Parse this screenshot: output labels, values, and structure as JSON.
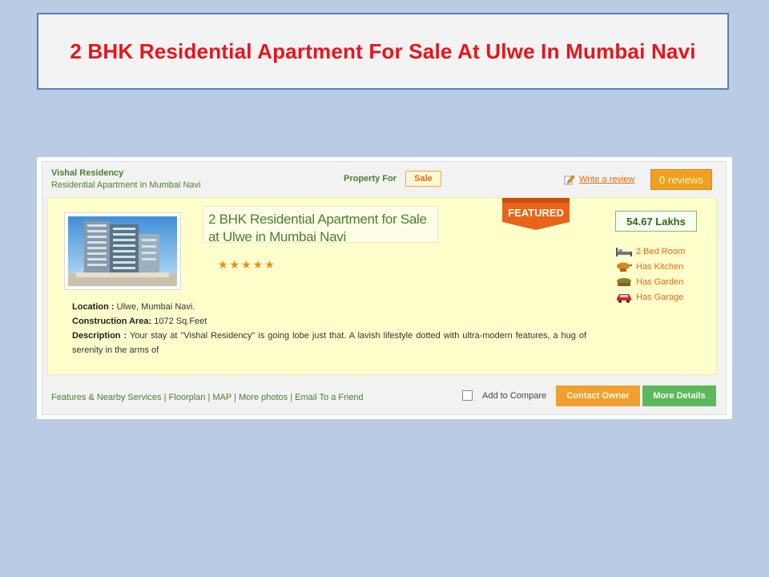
{
  "slide_title": "2 BHK Residential  Apartment  For Sale  At Ulwe In Mumbai  Navi",
  "listing": {
    "name": "Vishal Residency",
    "subtitle": "Residential Apartment in Mumbai Navi",
    "property_for_label": "Property For",
    "property_for_value": "Sale",
    "write_review": "Write a review",
    "reviews": "0 reviews",
    "title": "2 BHK Residential Apartment for Sale at Ulwe in Mumbai Navi",
    "rating_stars": 5,
    "featured": "FEATURED",
    "price": "54.67 Lakhs",
    "amenities": [
      {
        "label": "2 Bed Room",
        "icon": "bed-icon"
      },
      {
        "label": "Has Kitchen",
        "icon": "kitchen-icon"
      },
      {
        "label": "Has Garden",
        "icon": "garden-icon"
      },
      {
        "label": "Has Garage",
        "icon": "car-icon"
      }
    ],
    "location_label": "Location :",
    "location_value": "Ulwe, Mumbai Navi.",
    "area_label": "Construction Area:",
    "area_value": "1072 Sq.Feet",
    "description_label": "Description :",
    "description_value": "Your stay at \"Vishal Residency\" is going lobe just that. A lavish lifestyle dotted with ultra-modern features, a hug of serenity in the arms of"
  },
  "footer": {
    "links": [
      "Features & Nearby Services",
      "Floorplan",
      "MAP",
      "More photos",
      "Email To a Friend"
    ],
    "compare_label": "Add to Compare",
    "contact_button": "Contact Owner",
    "more_button": "More Details"
  },
  "colors": {
    "title_red": "#e8141b",
    "green_text": "#4e7d2a",
    "orange_accent": "#f0a020",
    "featured_orange": "#e8641a",
    "listing_bg": "#ffffcc"
  }
}
